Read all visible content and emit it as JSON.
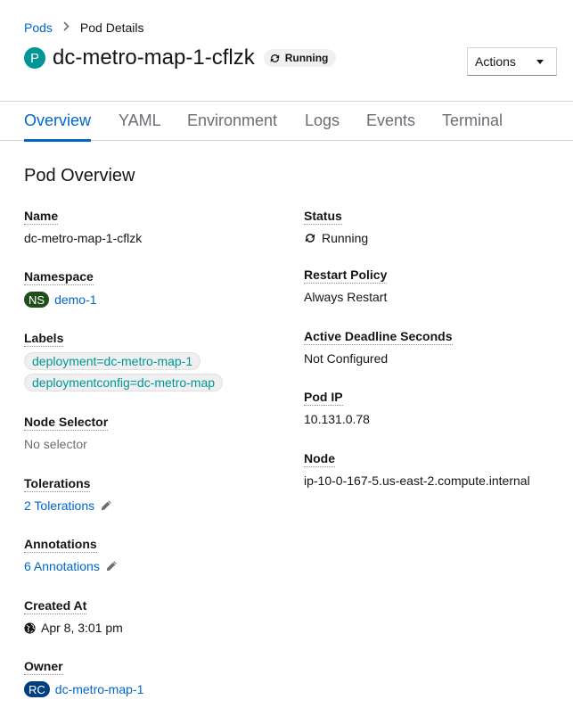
{
  "breadcrumb": {
    "parent": "Pods",
    "current": "Pod Details"
  },
  "header": {
    "icon_letter": "P",
    "title": "dc-metro-map-1-cflzk",
    "status": "Running",
    "actions_label": "Actions"
  },
  "tabs": [
    "Overview",
    "YAML",
    "Environment",
    "Logs",
    "Events",
    "Terminal"
  ],
  "section_title": "Pod Overview",
  "left": {
    "name": {
      "label": "Name",
      "value": "dc-metro-map-1-cflzk"
    },
    "namespace": {
      "label": "Namespace",
      "badge": "NS",
      "value": "demo-1"
    },
    "labels": {
      "label": "Labels",
      "values": [
        "deployment=dc-metro-map-1",
        "deploymentconfig=dc-metro-map"
      ]
    },
    "node_selector": {
      "label": "Node Selector",
      "value": "No selector"
    },
    "tolerations": {
      "label": "Tolerations",
      "value": "2 Tolerations"
    },
    "annotations": {
      "label": "Annotations",
      "value": "6 Annotations"
    },
    "created_at": {
      "label": "Created At",
      "value": "Apr 8, 3:01 pm"
    },
    "owner": {
      "label": "Owner",
      "badge": "RC",
      "value": "dc-metro-map-1"
    }
  },
  "right": {
    "status": {
      "label": "Status",
      "value": "Running"
    },
    "restart_policy": {
      "label": "Restart Policy",
      "value": "Always Restart"
    },
    "active_deadline": {
      "label": "Active Deadline Seconds",
      "value": "Not Configured"
    },
    "pod_ip": {
      "label": "Pod IP",
      "value": "10.131.0.78"
    },
    "node": {
      "label": "Node",
      "value": "ip-10-0-167-5.us-east-2.compute.internal"
    }
  },
  "colors": {
    "link": "#0066cc",
    "pod_icon": "#009596",
    "ns_badge": "#1e4f18",
    "rc_badge": "#004080"
  }
}
